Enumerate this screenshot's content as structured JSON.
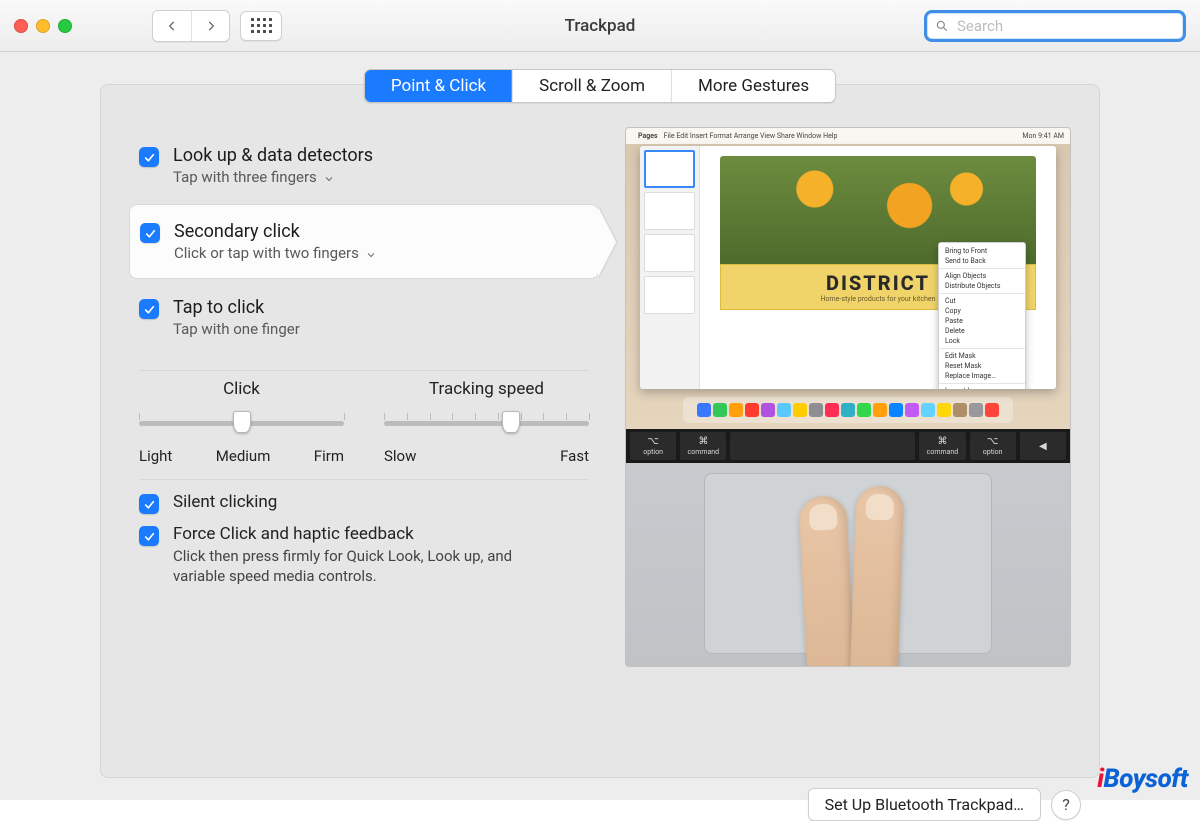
{
  "window": {
    "title": "Trackpad"
  },
  "search": {
    "placeholder": "Search"
  },
  "tabs": [
    {
      "label": "Point & Click",
      "active": true
    },
    {
      "label": "Scroll & Zoom",
      "active": false
    },
    {
      "label": "More Gestures",
      "active": false
    }
  ],
  "options": {
    "lookup": {
      "title": "Look up & data detectors",
      "subtitle": "Tap with three fingers",
      "checked": true,
      "dropdown": true
    },
    "secondary": {
      "title": "Secondary click",
      "subtitle": "Click or tap with two fingers",
      "checked": true,
      "dropdown": true,
      "selected": true
    },
    "taptoclick": {
      "title": "Tap to click",
      "subtitle": "Tap with one finger",
      "checked": true,
      "dropdown": false
    }
  },
  "sliders": {
    "click": {
      "label": "Click",
      "left": "Light",
      "mid": "Medium",
      "right": "Firm",
      "ticks": 3,
      "value_pct": 50
    },
    "tracking": {
      "label": "Tracking speed",
      "left": "Slow",
      "right": "Fast",
      "ticks": 10,
      "value_pct": 62
    }
  },
  "bottom": {
    "silent": {
      "title": "Silent clicking",
      "checked": true
    },
    "force": {
      "title": "Force Click and haptic feedback",
      "desc": "Click then press firmly for Quick Look, Look up, and variable speed media controls.",
      "checked": true
    }
  },
  "footer": {
    "bluetooth": "Set Up Bluetooth Trackpad…",
    "help": "?"
  },
  "preview": {
    "menubar_app": "Pages",
    "menubar_items": [
      "File",
      "Edit",
      "Insert",
      "Format",
      "Arrange",
      "View",
      "Share",
      "Window",
      "Help"
    ],
    "menubar_time": "Mon 9:41 AM",
    "banner_big": "DISTRICT",
    "banner_small": "Home-style products for your kitchen",
    "context_menu": [
      "Bring to Front",
      "Send to Back",
      "—",
      "Align Objects",
      "Distribute Objects",
      "—",
      "Cut",
      "Copy",
      "Paste",
      "Delete",
      "Lock",
      "—",
      "Edit Mask",
      "Reset Mask",
      "Replace Image…",
      "—",
      "Import Image"
    ],
    "keys": [
      {
        "sym": "⌥",
        "label": "option"
      },
      {
        "sym": "⌘",
        "label": "command"
      },
      {
        "sym": "",
        "label": ""
      },
      {
        "sym": "⌘",
        "label": "command"
      },
      {
        "sym": "⌥",
        "label": "option"
      },
      {
        "sym": "◀",
        "label": ""
      }
    ]
  },
  "watermark": "iBoysoft"
}
